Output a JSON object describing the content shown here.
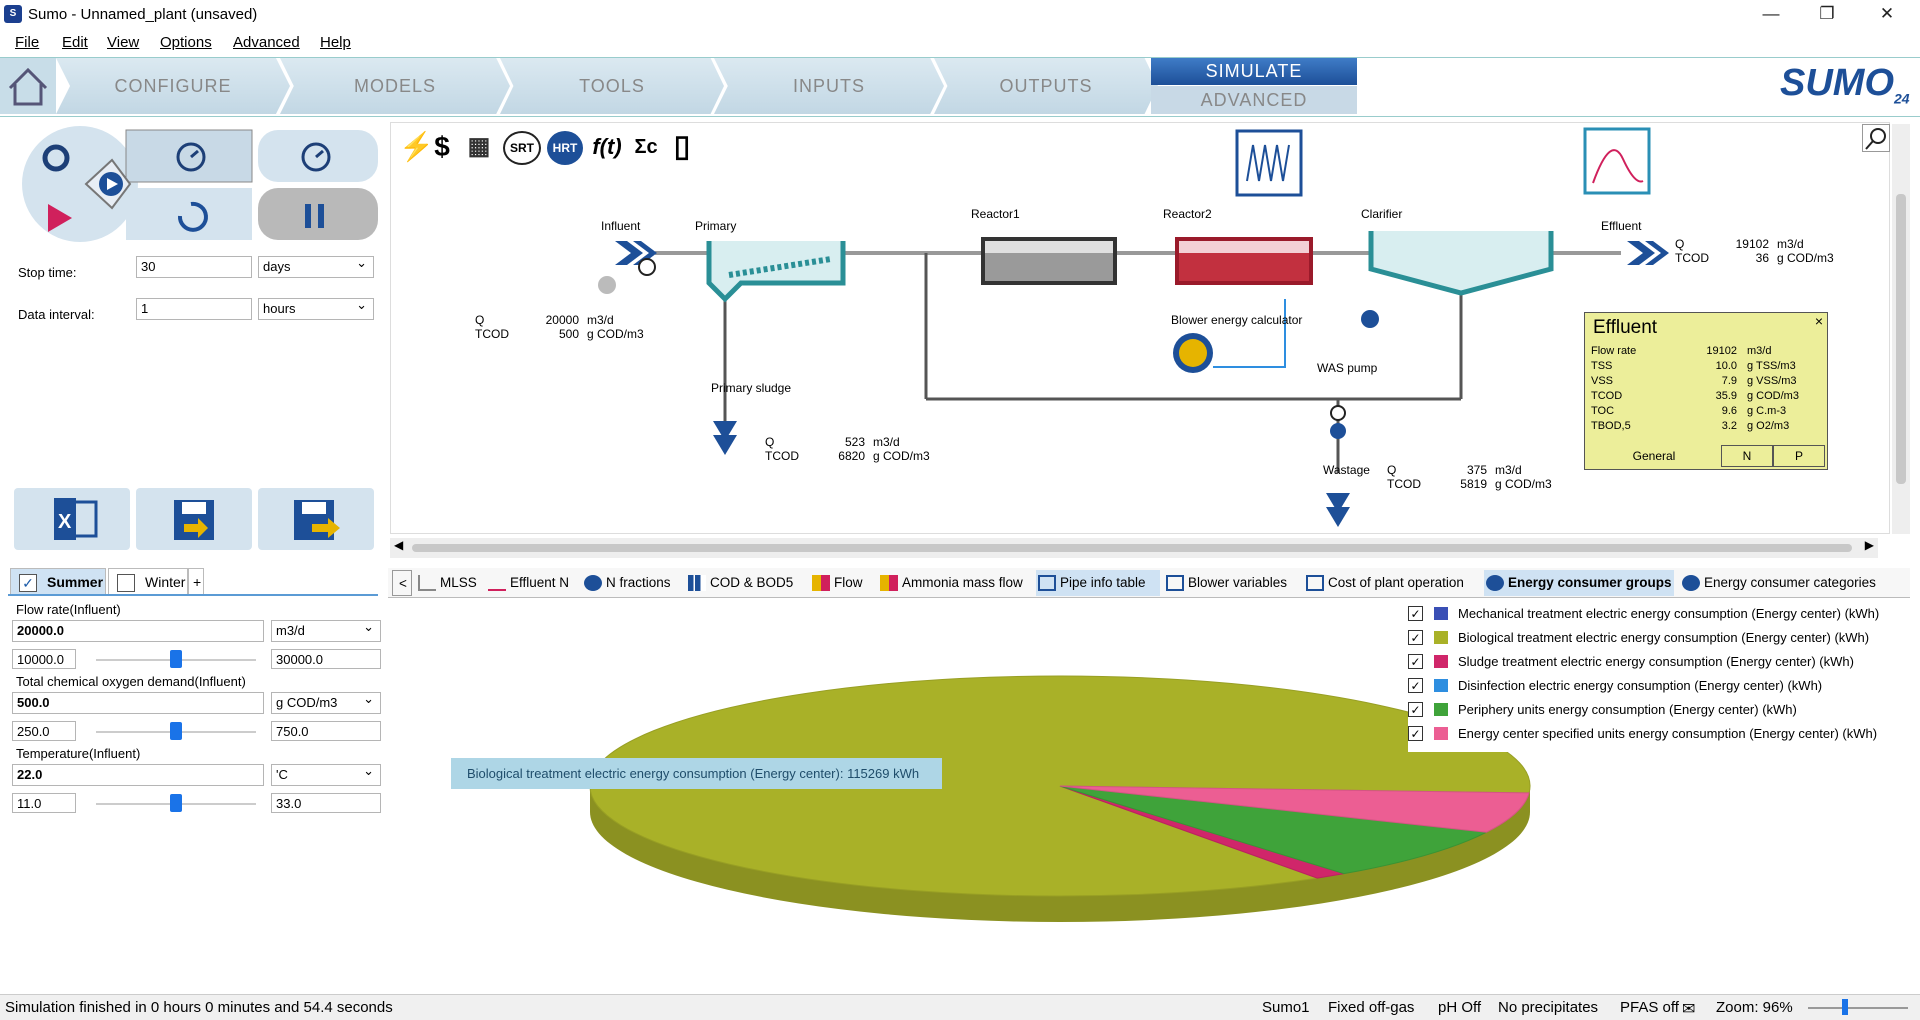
{
  "window": {
    "title": "Sumo - Unnamed_plant (unsaved)",
    "minimize": "—",
    "maximize": "❐",
    "close": "✕"
  },
  "menu": [
    "File",
    "Edit",
    "View",
    "Options",
    "Advanced",
    "Help"
  ],
  "ribbon": {
    "tabs": [
      "CONFIGURE",
      "MODELS",
      "TOOLS",
      "INPUTS",
      "OUTPUTS"
    ],
    "simulate": "SIMULATE",
    "advanced": "ADVANCED",
    "logo": "SUMO",
    "logo_version": "24"
  },
  "sim_controls": {
    "stop_time_label": "Stop time:",
    "stop_time_value": "30",
    "stop_time_unit": "days",
    "data_interval_label": "Data interval:",
    "data_interval_value": "1",
    "data_interval_unit": "hours"
  },
  "scenarios": {
    "summer": "Summer",
    "winter": "Winter",
    "add": "+"
  },
  "inputs": [
    {
      "label": "Flow rate(Influent)",
      "value": "20000.0",
      "unit": "m3/d",
      "min": "10000.0",
      "max": "30000.0",
      "position": 0.5
    },
    {
      "label": "Total chemical oxygen demand(Influent)",
      "value": "500.0",
      "unit": "g COD/m3",
      "min": "250.0",
      "max": "750.0",
      "position": 0.5
    },
    {
      "label": "Temperature(Influent)",
      "value": "22.0",
      "unit": "'C",
      "min": "11.0",
      "max": "33.0",
      "position": 0.5
    }
  ],
  "diagram": {
    "units": [
      "Influent",
      "Primary",
      "Reactor1",
      "Reactor2",
      "Clarifier",
      "Effluent",
      "Blower energy calculator",
      "WAS pump",
      "Primary sludge",
      "Wastage"
    ],
    "influent_q": {
      "Q": "Q",
      "q_val": "20000",
      "q_unit": "m3/d",
      "TCOD": "TCOD",
      "t_val": "500",
      "t_unit": "g COD/m3"
    },
    "primary_sludge_q": {
      "Q": "Q",
      "q_val": "523",
      "q_unit": "m3/d",
      "TCOD": "TCOD",
      "t_val": "6820",
      "t_unit": "g COD/m3"
    },
    "wastage_q": {
      "Q": "Q",
      "q_val": "375",
      "q_unit": "m3/d",
      "TCOD": "TCOD",
      "t_val": "5819",
      "t_unit": "g COD/m3"
    },
    "effluent_q": {
      "Q": "Q",
      "q_val": "19102",
      "q_unit": "m3/d",
      "TCOD": "TCOD",
      "t_val": "36",
      "t_unit": "g COD/m3"
    },
    "toolbar": [
      "⚡",
      "$",
      "▦",
      "SRT",
      "HRT",
      "f(t)",
      "Σc",
      "▯"
    ]
  },
  "effluent_popup": {
    "title": "Effluent",
    "close": "×",
    "rows": [
      {
        "name": "Flow rate",
        "value": "19102",
        "unit": "m3/d"
      },
      {
        "name": "TSS",
        "value": "10.0",
        "unit": "g TSS/m3"
      },
      {
        "name": "VSS",
        "value": "7.9",
        "unit": "g VSS/m3"
      },
      {
        "name": "TCOD",
        "value": "35.9",
        "unit": "g COD/m3"
      },
      {
        "name": "TOC",
        "value": "9.6",
        "unit": "g C.m-3"
      },
      {
        "name": "TBOD,5",
        "value": "3.2",
        "unit": "g O2/m3"
      }
    ],
    "tabs": [
      "General",
      "N",
      "P"
    ]
  },
  "output_tabs": [
    "<",
    "MLSS",
    "Effluent N",
    "N fractions",
    "COD & BOD5",
    "Flow",
    "Ammonia mass flow",
    "Pipe info table",
    "Blower variables",
    "Cost of plant operation",
    "Energy consumer groups",
    "Energy consumer categories"
  ],
  "chart_data": {
    "type": "pie",
    "categories": [
      "Mechanical treatment electric energy consumption (Energy center) (kWh)",
      "Biological treatment electric energy consumption (Energy center) (kWh)",
      "Sludge treatment electric energy consumption (Energy center) (kWh)",
      "Disinfection electric energy consumption (Energy center) (kWh)",
      "Periphery units energy consumption (Energy center) (kWh)",
      "Energy center specified units energy consumption (Energy center) (kWh)"
    ],
    "values": [
      0,
      115269,
      1500,
      0,
      10500,
      8000
    ],
    "colors": [
      "#3a4fb5",
      "#a9b128",
      "#d0266a",
      "#2e8ee0",
      "#3fa33a",
      "#ec5e93"
    ],
    "checked": [
      true,
      true,
      true,
      true,
      true,
      true
    ],
    "tooltip": "Biological treatment electric energy consumption (Energy center): 115269 kWh",
    "legend_position": "top-right"
  },
  "status": {
    "message": "Simulation finished in 0 hours 0 minutes and 54.4 seconds",
    "model": "Sumo1",
    "offgas": "Fixed off-gas",
    "ph": "pH Off",
    "precip": "No precipitates",
    "pfas": "PFAS off",
    "zoom": "Zoom: 96%"
  }
}
